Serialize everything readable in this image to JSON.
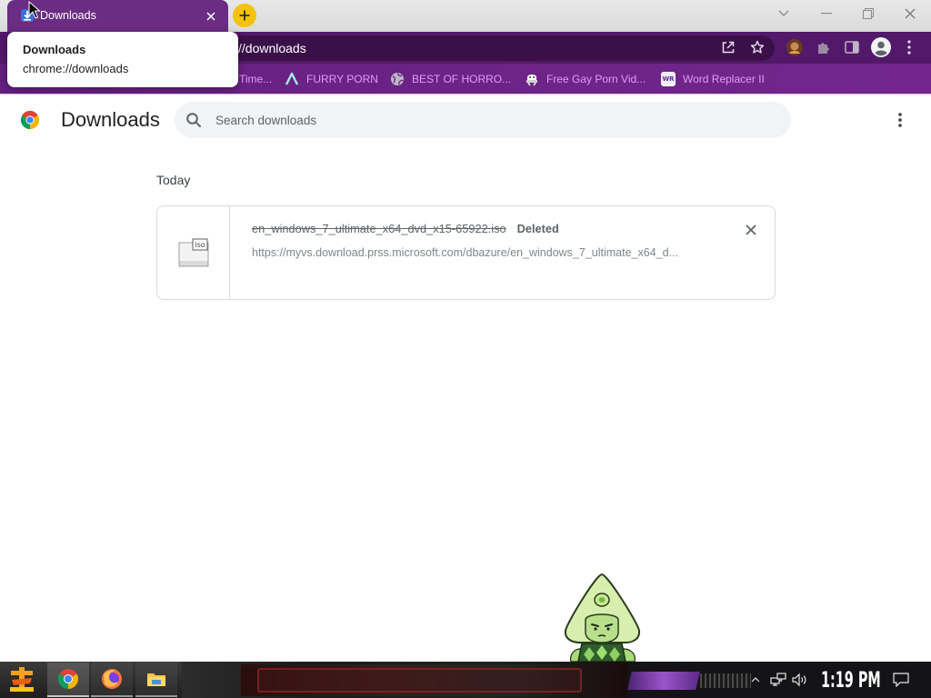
{
  "window": {
    "tab": {
      "title": "Downloads",
      "favicon_icon": "download-icon",
      "close_icon": "close-icon"
    },
    "new_tab_icon": "plus-icon",
    "controls": [
      "chevron-down-icon",
      "minimize-icon",
      "restore-icon",
      "close-icon"
    ]
  },
  "tooltip": {
    "title": "Downloads",
    "url": "chrome://downloads"
  },
  "toolbar": {
    "omnibox_text": "//downloads",
    "icons": [
      "share-icon",
      "star-icon",
      "avatar-photo-icon",
      "puzzle-icon",
      "side-panel-icon",
      "profile-icon",
      "kebab-menu-icon"
    ]
  },
  "bookmarks": [
    {
      "label": "Time..."
    },
    {
      "label": "FURRY PORN",
      "icon": "lambda-icon"
    },
    {
      "label": "BEST OF HORRO...",
      "icon": "globe-icon"
    },
    {
      "label": "Free Gay Porn Vid...",
      "icon": "figure-icon"
    },
    {
      "label": "Word Replacer II",
      "icon": "wr-icon",
      "icon_text": "WR"
    }
  ],
  "page": {
    "title": "Downloads",
    "logo_icon": "chrome-logo-icon",
    "search": {
      "placeholder": "Search downloads",
      "icon": "search-icon"
    },
    "menu_icon": "kebab-menu-icon",
    "sections": [
      {
        "label": "Today",
        "items": [
          {
            "file_name": "en_windows_7_ultimate_x64_dvd_x15-65922.iso",
            "status": "Deleted",
            "deleted": true,
            "url": "https://myvs.download.prss.microsoft.com/dbazure/en_windows_7_ultimate_x64_d...",
            "file_type": "iso",
            "remove_icon": "close-icon"
          }
        ]
      }
    ]
  },
  "desktop": {
    "mascot_icon": "peridot-mascot-icon"
  },
  "taskbar": {
    "pinned_apps": [
      "start-logo-icon",
      "chrome-icon",
      "firefox-icon",
      "folder-icon"
    ],
    "tray_icons": [
      "chevron-up-icon",
      "network-icon",
      "volume-icon",
      "notification-icon"
    ],
    "clock": "1:19 PM"
  },
  "theme": {
    "frame_purple": "#52196a",
    "tab_purple": "#6b2c83",
    "omnibox_purple": "#3b1049",
    "bookmark_bar_purple": "#6c2386",
    "bookmark_text": "#e29bf7",
    "new_tab_yellow": "#f4c20d",
    "page_background": "#ffffff",
    "taskbar_dark": "#141416"
  }
}
